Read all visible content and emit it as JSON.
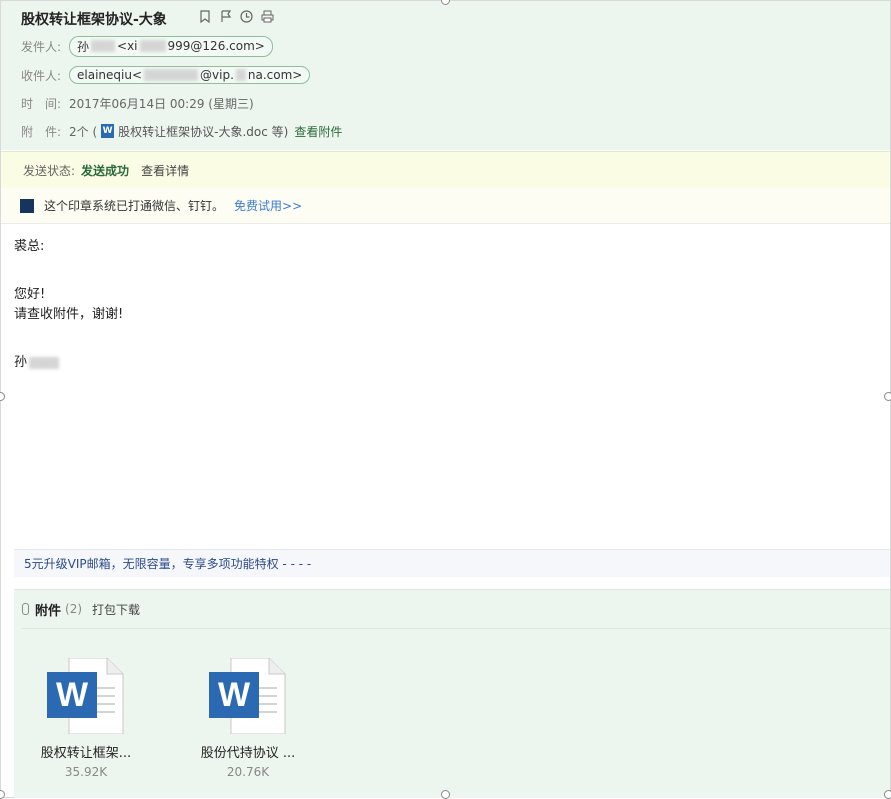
{
  "subject": "股权转让框架协议-大象",
  "from": {
    "label": "发件人:",
    "name_visible": "孙",
    "email_prefix": "<xi",
    "email_suffix": "999@126.com>"
  },
  "to": {
    "label": "收件人:",
    "name": "elaineqiu",
    "email_prefix": "<",
    "email_mid": "@vip.",
    "email_suffix": "na.com>"
  },
  "time": {
    "label": "时　间:",
    "value": "2017年06月14日 00:29 (星期三)"
  },
  "attachments_row": {
    "label": "附　件:",
    "count_text": "2个 (",
    "file_text": "股权转让框架协议-大象.doc 等)",
    "view_link": "查看附件"
  },
  "status": {
    "label": "发送状态:",
    "value": "发送成功",
    "details": "查看详情"
  },
  "ad": {
    "text": "这个印章系统已打通微信、钉钉。",
    "link": "免费试用>>"
  },
  "body": {
    "greeting": "裘总:",
    "line1": "您好!",
    "line2": "请查收附件，谢谢!",
    "signature": "孙"
  },
  "vip_bar": "5元升级VIP邮箱，无限容量，专享多项功能特权 - - - -",
  "attachments": {
    "title": "附件",
    "count": "(2)",
    "download_all": "打包下载",
    "files": [
      {
        "name": "股权转让框架...",
        "size": "35.92K",
        "icon": "word-doc-icon"
      },
      {
        "name": "股份代持协议 ...",
        "size": "20.76K",
        "icon": "word-doc-icon"
      }
    ]
  },
  "colors": {
    "header_bg": "#edf5ef",
    "status_bg": "#fbfce4",
    "success": "#2a6a3a",
    "link": "#3b7bd0",
    "word_blue": "#2b6ab3"
  }
}
